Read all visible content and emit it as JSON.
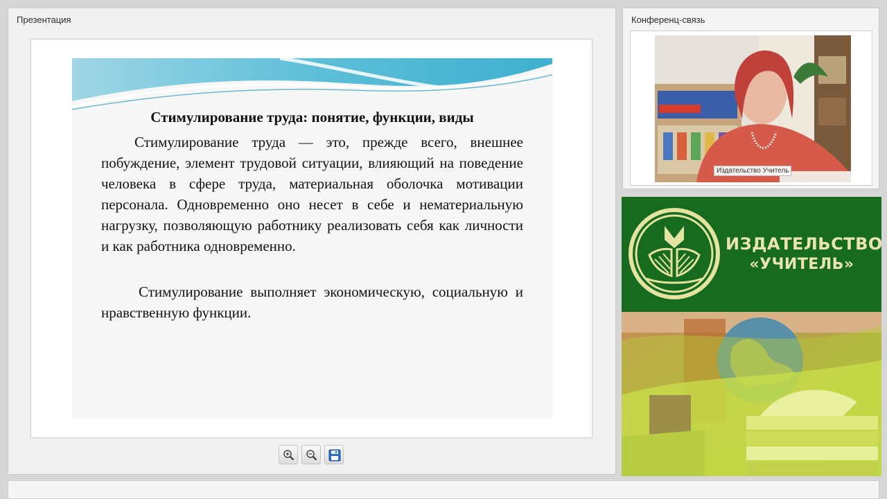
{
  "presentation_panel": {
    "title": "Презентация",
    "slide": {
      "title": "Стимулирование труда: понятие, функции, виды",
      "paragraph1": "Стимулирование труда — это, прежде всего, внешнее побуждение, элемент трудовой ситуации, влияющий на поведение человека в сфере труда, материальная оболочка мотивации персонала. Одновременно оно несет в себе и нематериальную нагрузку, позволяющую работнику реализовать себя как личности и как работника одновременно.",
      "paragraph2": "Стимулирование выполняет экономическую, социальную и нравственную функции."
    },
    "toolbar": {
      "zoom_in_icon": "zoom-in-icon",
      "zoom_out_icon": "zoom-out-icon",
      "save_icon": "save-icon"
    }
  },
  "conference_panel": {
    "title": "Конференц-связь",
    "video_label": "Издательство Учитель"
  },
  "promo": {
    "line1": "ИЗДАТЕЛЬСТВО",
    "line2": "«УЧИТЕЛЬ»"
  },
  "colors": {
    "promo_green": "#176b1f",
    "promo_text": "#e9e4b0",
    "banner_blue": "#5bbfd9"
  }
}
